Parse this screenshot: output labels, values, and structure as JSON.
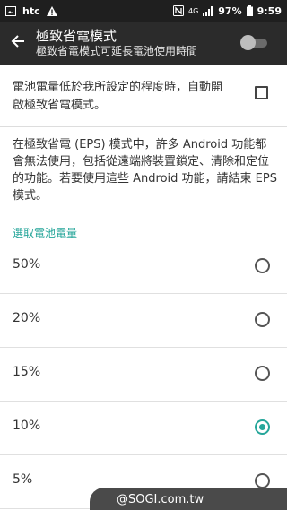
{
  "status_bar": {
    "brand": "htc",
    "network": "4G",
    "battery_percent": "97%",
    "time": "9:59",
    "icons": [
      "image-icon",
      "htc-logo",
      "warning-icon",
      "nfc-icon",
      "data-icon",
      "signal-icon",
      "battery-icon"
    ]
  },
  "app_bar": {
    "title": "極致省電模式",
    "subtitle": "極致省電模式可延長電池使用時間",
    "toggle_on": false
  },
  "auto_enable": {
    "label": "電池電量低於我所設定的程度時，自動開啟極致省電模式。",
    "checked": false
  },
  "description": "在極致省電 (EPS) 模式中，許多 Android 功能都會無法使用，包括從遠端將裝置鎖定、清除和定位的功能。若要使用這些 Android 功能，請結束 EPS 模式。",
  "section_label": "選取電池電量",
  "options": [
    {
      "label": "50%",
      "selected": false
    },
    {
      "label": "20%",
      "selected": false
    },
    {
      "label": "15%",
      "selected": false
    },
    {
      "label": "10%",
      "selected": true
    },
    {
      "label": "5%",
      "selected": false
    }
  ],
  "watermark": "@SOGI.com.tw",
  "colors": {
    "accent": "#26a69a",
    "app_bar": "#2b2b2b",
    "status_bar": "#1f1f1f"
  }
}
